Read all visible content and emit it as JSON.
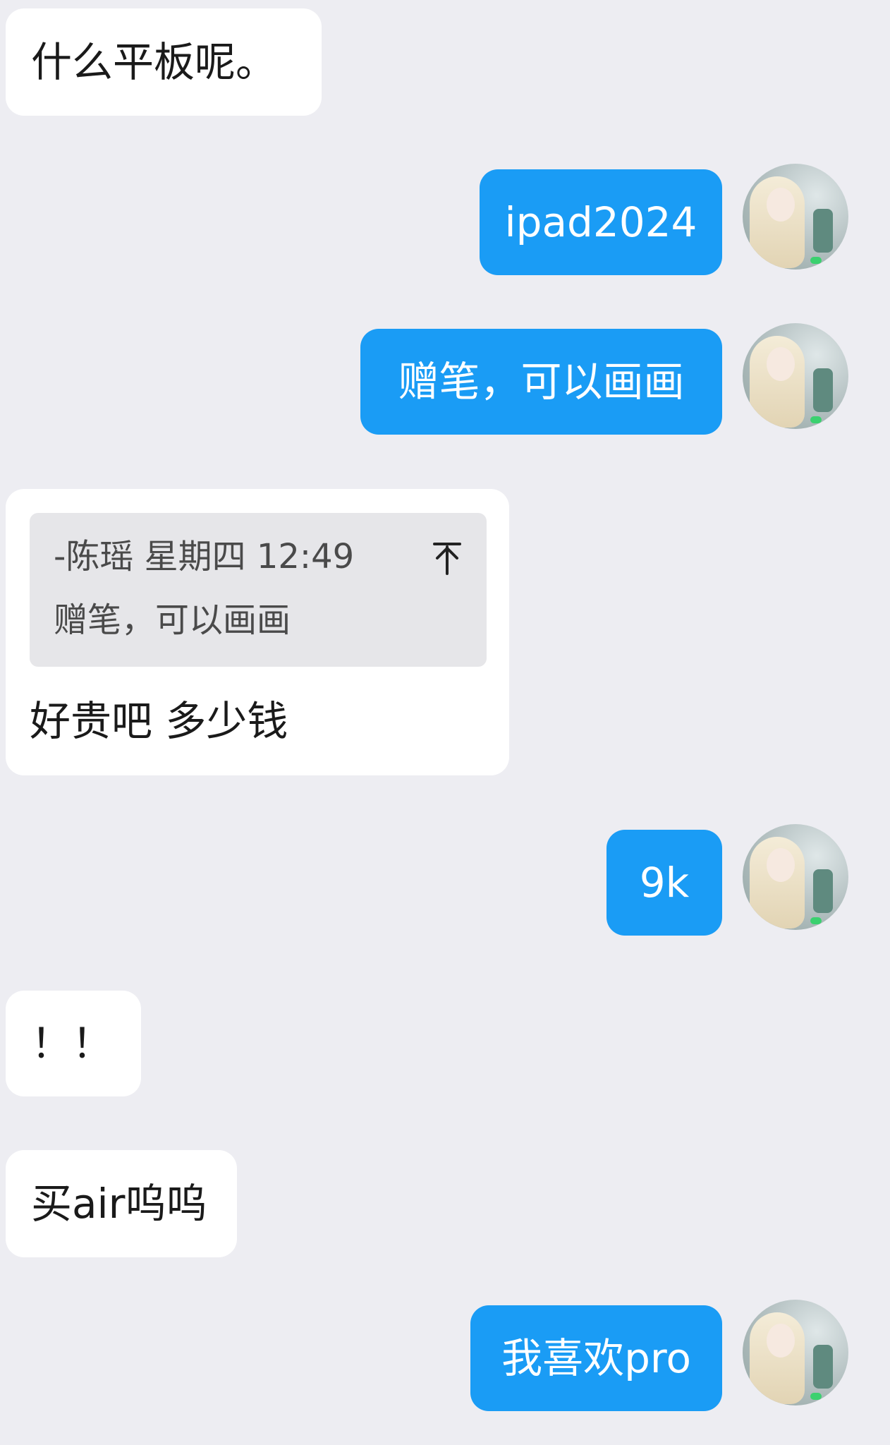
{
  "messages": {
    "m1": "什么平板呢。",
    "m2": "ipad2024",
    "m3": "赠笔，可以画画",
    "m4": {
      "quote_meta": "-陈瑶 星期四 12:49",
      "quote_text": "赠笔，可以画画",
      "quote_icon": "arrow-up-to-top-icon",
      "text": "好贵吧 多少钱"
    },
    "m5": "9k",
    "m6": "！！",
    "m7": "买air呜呜",
    "m8": "我喜欢pro"
  },
  "colors": {
    "background": "#ededf2",
    "incoming_bubble": "#ffffff",
    "outgoing_bubble": "#1a9cf5",
    "quote_background": "#e6e6e9"
  }
}
